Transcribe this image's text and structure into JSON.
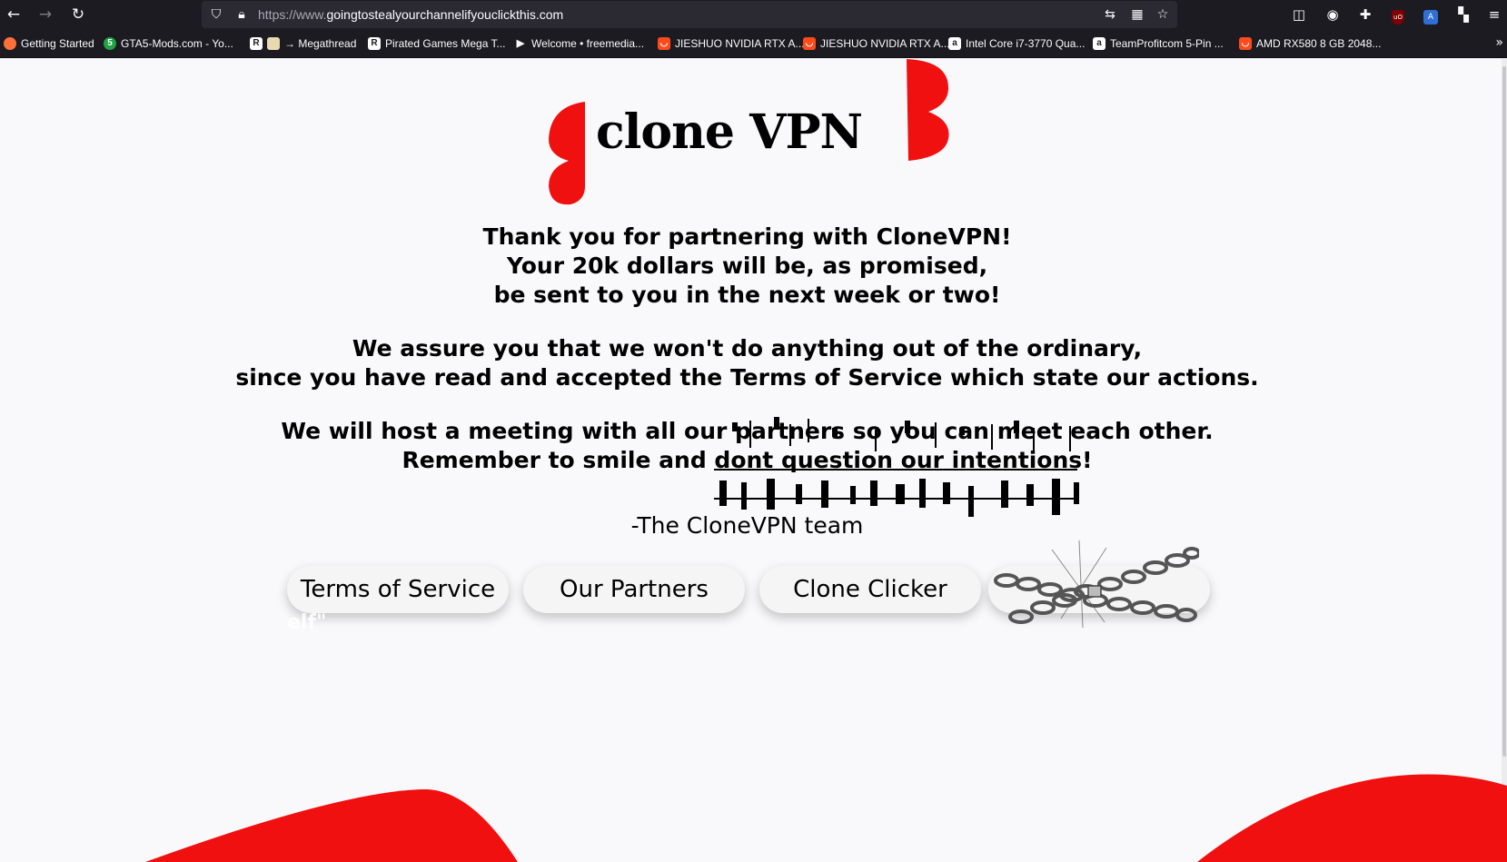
{
  "browser": {
    "url_protocol": "https://www.",
    "url_domain": "goingtostealyourchannelifyouclickthis.com",
    "bookmarks": [
      {
        "label": "Getting Started",
        "favicon_color": "#ff7139"
      },
      {
        "label": "GTA5-Mods.com - Yo...",
        "favicon_color": "#20a345"
      },
      {
        "label": "→ Megathread",
        "favicon_color": "#ffffff"
      },
      {
        "label": "Pirated Games Mega T...",
        "favicon_color": "#ffffff"
      },
      {
        "label": "Welcome • freemedia...",
        "favicon_color": "#ffffff"
      },
      {
        "label": "JIESHUO NVIDIA RTX A...",
        "favicon_color": "#ff4a1c"
      },
      {
        "label": "JIESHUO NVIDIA RTX A...",
        "favicon_color": "#ff4a1c"
      },
      {
        "label": "Intel Core i7-3770 Qua...",
        "favicon_color": "#ffffff"
      },
      {
        "label": "TeamProfitcom 5-Pin ...",
        "favicon_color": "#ffffff"
      },
      {
        "label": "AMD RX580 8 GB 2048...",
        "favicon_color": "#ff4a1c"
      }
    ]
  },
  "page": {
    "logo": {
      "text": "clone VPN",
      "accent_color": "#f01010"
    },
    "message": {
      "p1_l1": "Thank you for partnering with CloneVPN!",
      "p1_l2": "Your 20k dollars will be, as promised,",
      "p1_l3": "be sent to you in the next week or two!",
      "p2_l1": "We assure you that we won't do anything out of the ordinary,",
      "p2_l2": "since you have read and accepted the Terms of Service which state our actions.",
      "p3_l1": "We will host a meeting with all our partners so you can meet each other.",
      "p3_l2": "Remember to smile and dont question our intentions!"
    },
    "signature": "-The CloneVPN team",
    "nav": [
      {
        "label": "Terms of Service"
      },
      {
        "label": "Our Partners"
      },
      {
        "label": "Clone Clicker"
      },
      {
        "label": ""
      }
    ],
    "ghost_text": "elf\""
  }
}
